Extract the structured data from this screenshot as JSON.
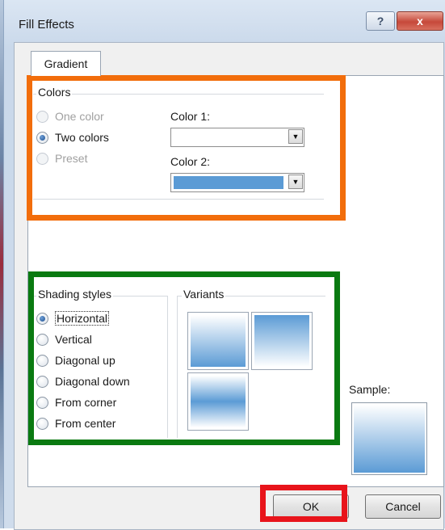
{
  "window": {
    "title": "Fill Effects",
    "help_label": "?",
    "close_label": "x"
  },
  "tab": {
    "label": "Gradient"
  },
  "colors_group": {
    "label": "Colors",
    "options": [
      {
        "label": "One color",
        "state": "disabled"
      },
      {
        "label": "Two colors",
        "state": "checked"
      },
      {
        "label": "Preset",
        "state": "disabled"
      }
    ],
    "color1": {
      "label": "Color 1:",
      "value": "",
      "swatch": "#ffffff"
    },
    "color2": {
      "label": "Color 2:",
      "value": "",
      "swatch": "#5b9bd5"
    }
  },
  "shading_group": {
    "label": "Shading styles",
    "options": [
      {
        "label": "Horizontal",
        "state": "checked"
      },
      {
        "label": "Vertical",
        "state": "unchecked"
      },
      {
        "label": "Diagonal up",
        "state": "unchecked"
      },
      {
        "label": "Diagonal down",
        "state": "unchecked"
      },
      {
        "label": "From corner",
        "state": "unchecked"
      },
      {
        "label": "From center",
        "state": "unchecked"
      }
    ]
  },
  "variants_group": {
    "label": "Variants"
  },
  "sample": {
    "label": "Sample:"
  },
  "buttons": {
    "ok": "OK",
    "cancel": "Cancel"
  },
  "colors": {
    "gradient_blue": "#5b9bd5",
    "highlight_orange": "#f26d0b",
    "highlight_green": "#0a7a11",
    "highlight_red": "#e8141b"
  }
}
